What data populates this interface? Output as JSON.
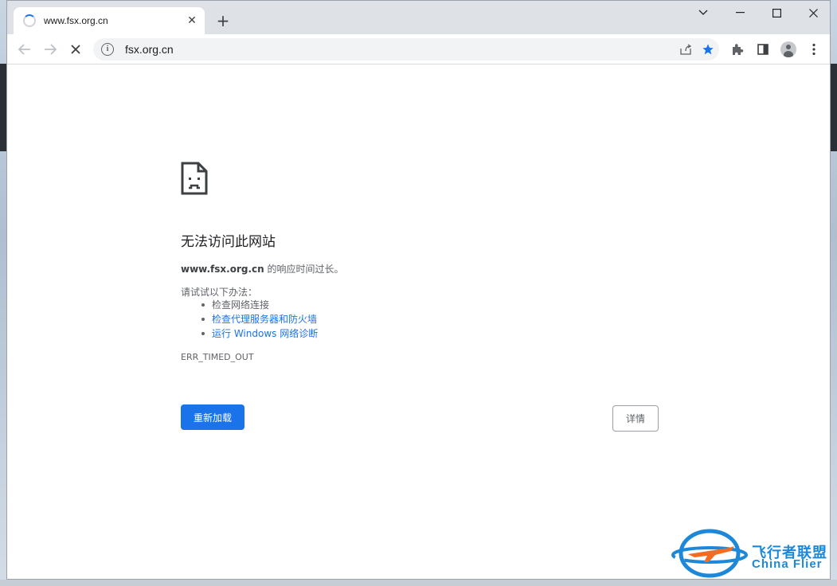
{
  "tab": {
    "title": "www.fsx.org.cn",
    "close_glyph": "✕",
    "new_tab_glyph": "+"
  },
  "window_controls": {
    "dropdown_glyph": "⌄",
    "minimize_glyph": "—",
    "maximize_glyph": "☐",
    "close_glyph": "✕"
  },
  "toolbar": {
    "back_glyph": "←",
    "forward_glyph": "→",
    "stop_glyph": "✕",
    "url": "fsx.org.cn",
    "share_glyph": "⇪",
    "bookmark_glyph": "★",
    "extensions_glyph": "✱",
    "sidepanel_glyph": "◧",
    "menu_glyph": "⋮"
  },
  "error_page": {
    "title": "无法访问此网站",
    "host": "www.fsx.org.cn",
    "desc_suffix": " 的响应时间过长。",
    "try_label": "请试试以下办法：",
    "suggestions": {
      "0": "检查网络连接",
      "1": "检查代理服务器和防火墙",
      "2": "运行 Windows 网络诊断"
    },
    "error_code": "ERR_TIMED_OUT",
    "reload_label": "重新加载",
    "details_label": "详情"
  },
  "watermark": {
    "cn_text": "飞行者联盟",
    "en_text": "China Flier"
  },
  "colors": {
    "accent": "#1a73e8",
    "watermark": "#1e88d8",
    "text_secondary": "#5f6368",
    "bookmark_star": "#1a73e8"
  }
}
